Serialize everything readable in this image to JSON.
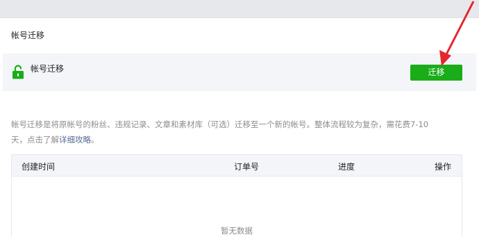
{
  "page": {
    "title": "帐号迁移"
  },
  "panel": {
    "label": "帐号迁移",
    "button_label": "迁移",
    "accent_color": "#1aad19",
    "lock_icon": "lock-open-icon"
  },
  "description": {
    "line1": "帐号迁移是将原帐号的粉丝、违规记录、文章和素材库（可选）迁移至一个新的帐号。整体流程较为复杂，需花费7-10",
    "line2_prefix": "天，点击了解",
    "link_text": "详细攻略",
    "line2_suffix": "。"
  },
  "table": {
    "columns": [
      "创建时间",
      "订单号",
      "进度",
      "操作"
    ],
    "rows": [],
    "empty_text": "暂无数据"
  },
  "annotation": {
    "arrow_color": "#e4272d"
  }
}
